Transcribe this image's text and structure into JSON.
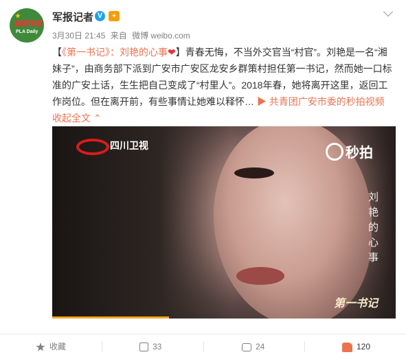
{
  "account": {
    "name": "军报记者",
    "avatar_text": "解放军报",
    "avatar_sub": "PLA Daily"
  },
  "meta": {
    "time": "3月30日 21:45",
    "via": "来自",
    "source": "微博 weibo.com"
  },
  "post": {
    "open_bracket": "【",
    "topic": "《第一书记》：刘艳的心事",
    "heart": "❤",
    "close_bracket": "】",
    "text": "青春无悔，不当外交官当“村官”。刘艳是一名“湘妹子”，由商务部下派到广安市广安区龙安乡群策村担任第一书记，然而她一口标准的广安土话，生生把自己变成了“村里人”。2018年春，她将离开这里，返回工作岗位。但在离开前，有些事情让她难以释怀… ",
    "video_link": "共青团广安市委的秒拍视频",
    "collapse": "收起全文",
    "collapse_icon": "chevron-up-icon"
  },
  "video": {
    "channel": "四川卫视",
    "watermark": "秒拍",
    "title": "刘艳的心事",
    "brand": "第一书记",
    "progress": 0.34
  },
  "actions": {
    "favorite": "收藏",
    "share": "33",
    "comment": "24",
    "like": "120"
  },
  "colors": {
    "link": "#eb7350",
    "verify": "#1da1f2",
    "progress": "#f2a51f"
  }
}
